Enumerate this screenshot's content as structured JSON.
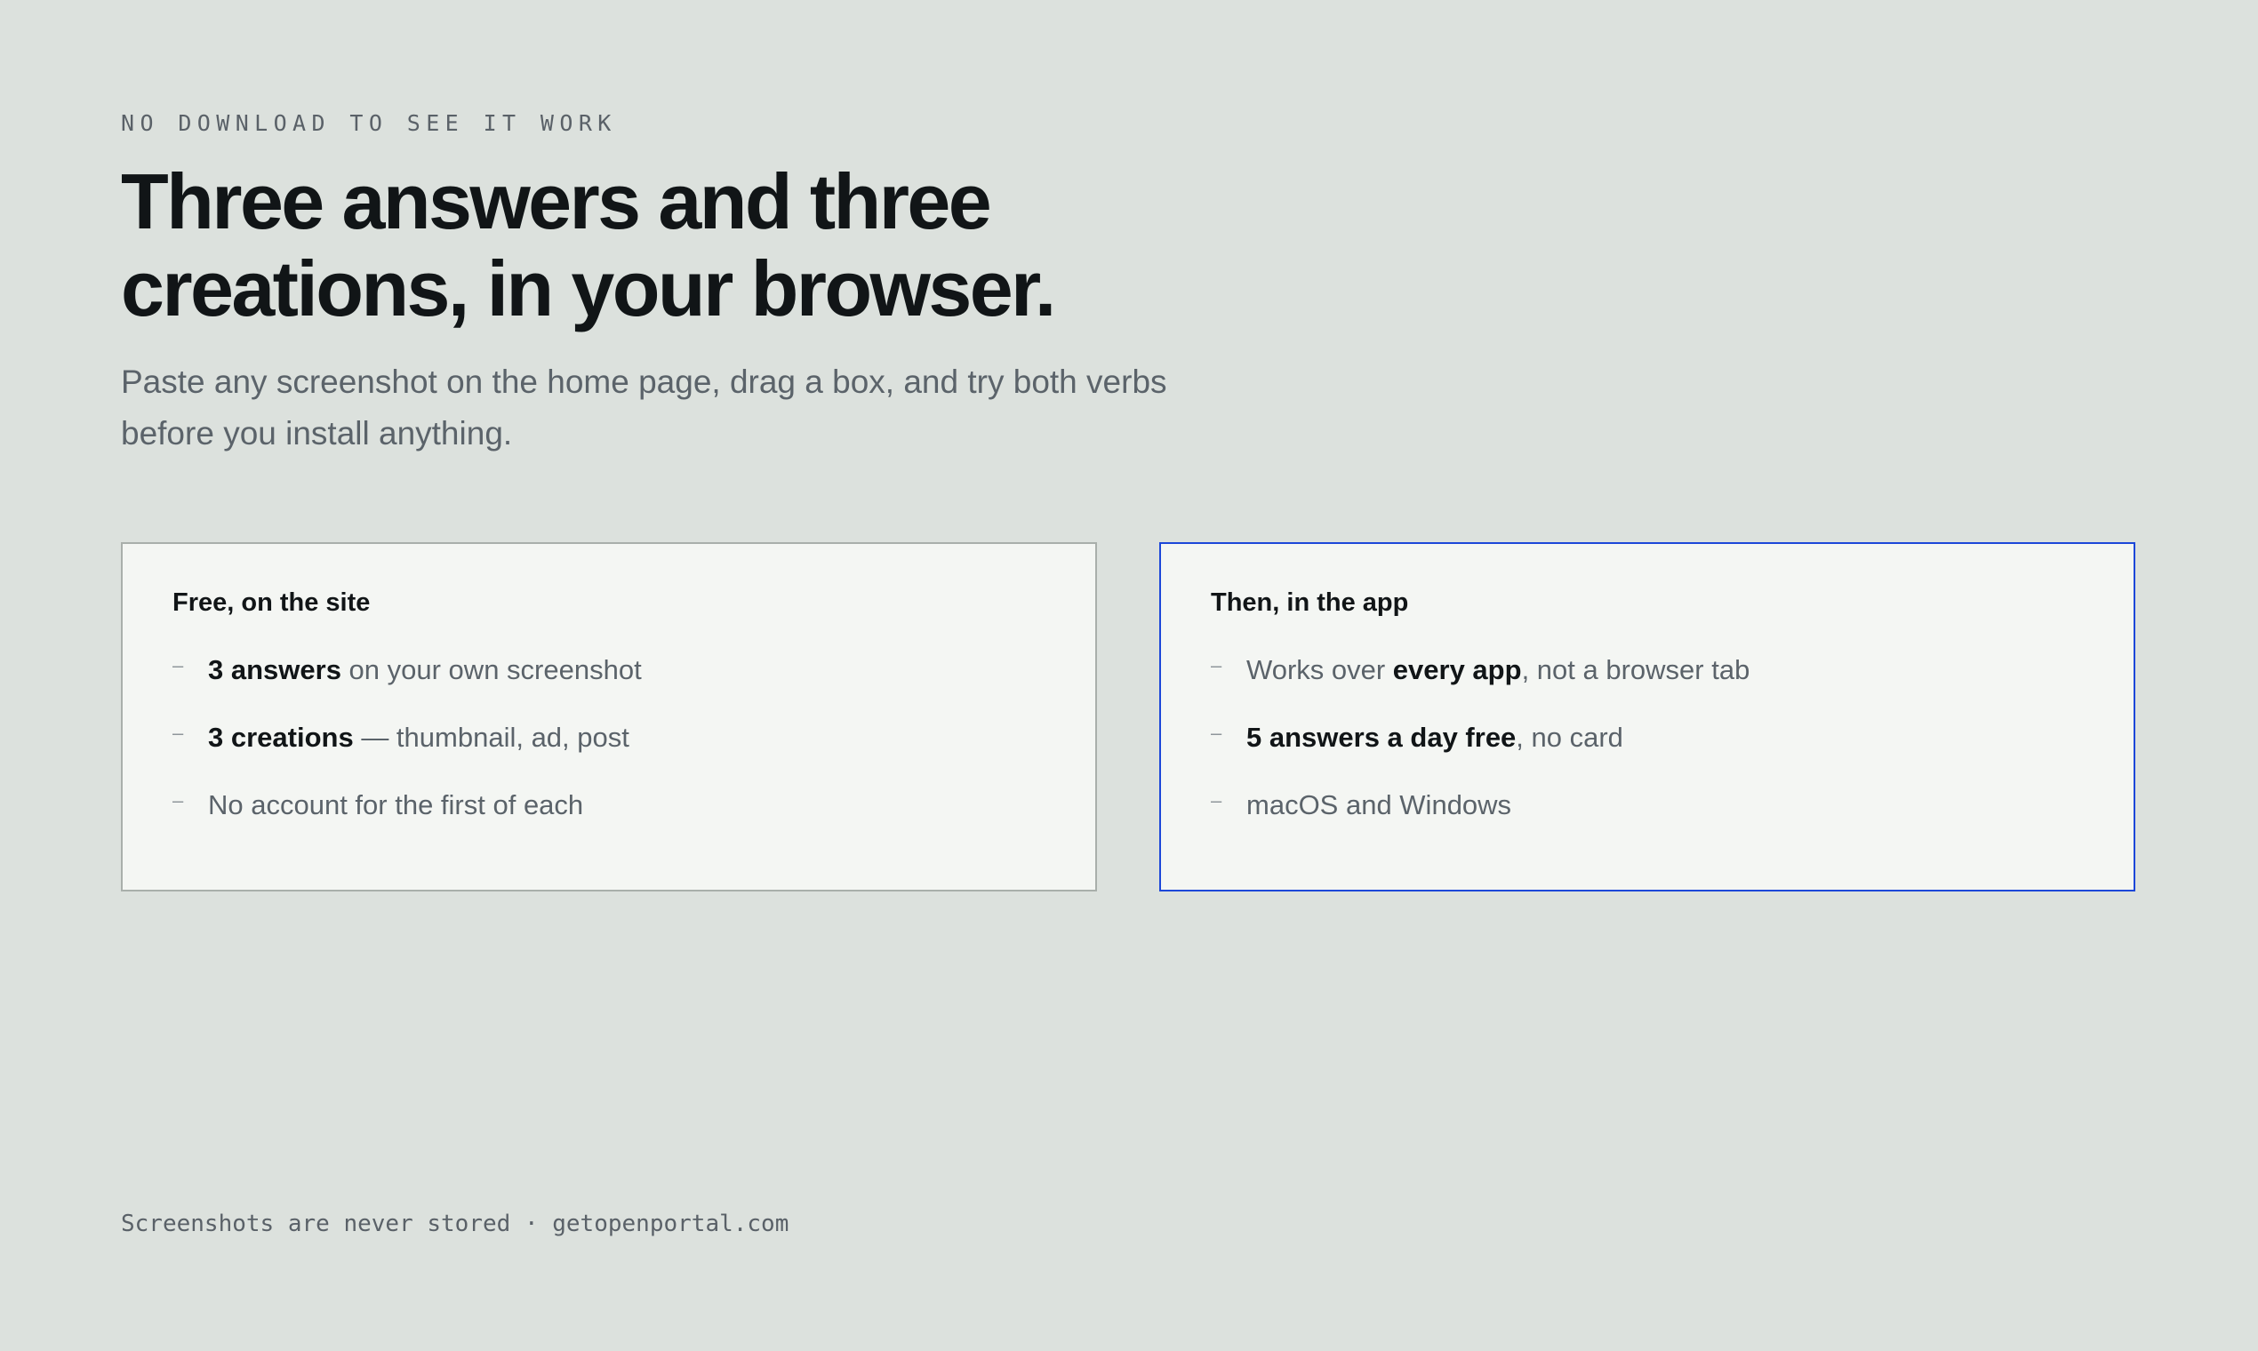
{
  "hero": {
    "eyebrow": "NO DOWNLOAD TO SEE IT WORK",
    "headline_line1": "Three answers and three",
    "headline_line2": "creations, in your browser.",
    "subhead_line1": "Paste any screenshot on the home page, drag a box, and try both verbs",
    "subhead_line2": "before you install anything."
  },
  "cards": {
    "free": {
      "title": "Free, on the site",
      "items": [
        {
          "bold": "3 answers",
          "before": "",
          "after": " on your own screenshot"
        },
        {
          "bold": "3 creations",
          "before": "",
          "after": " — thumbnail, ad, post"
        },
        {
          "bold": "",
          "before": "No account for the first of each",
          "after": ""
        }
      ]
    },
    "app": {
      "title": "Then, in the app",
      "items": [
        {
          "before": "Works over ",
          "bold": "every app",
          "after": ", not a browser tab"
        },
        {
          "before": "",
          "bold": "5 answers a day free",
          "after": ", no card"
        },
        {
          "before": "macOS and Windows",
          "bold": "",
          "after": ""
        }
      ]
    }
  },
  "footer": {
    "text": "Screenshots are never stored · getopenportal.com"
  },
  "colors": {
    "background": "#dce1dd",
    "card_background": "#f4f6f3",
    "accent_border": "#1c47d9",
    "neutral_border": "#a9afab",
    "text_primary": "#111517",
    "text_secondary": "#5b636a"
  }
}
